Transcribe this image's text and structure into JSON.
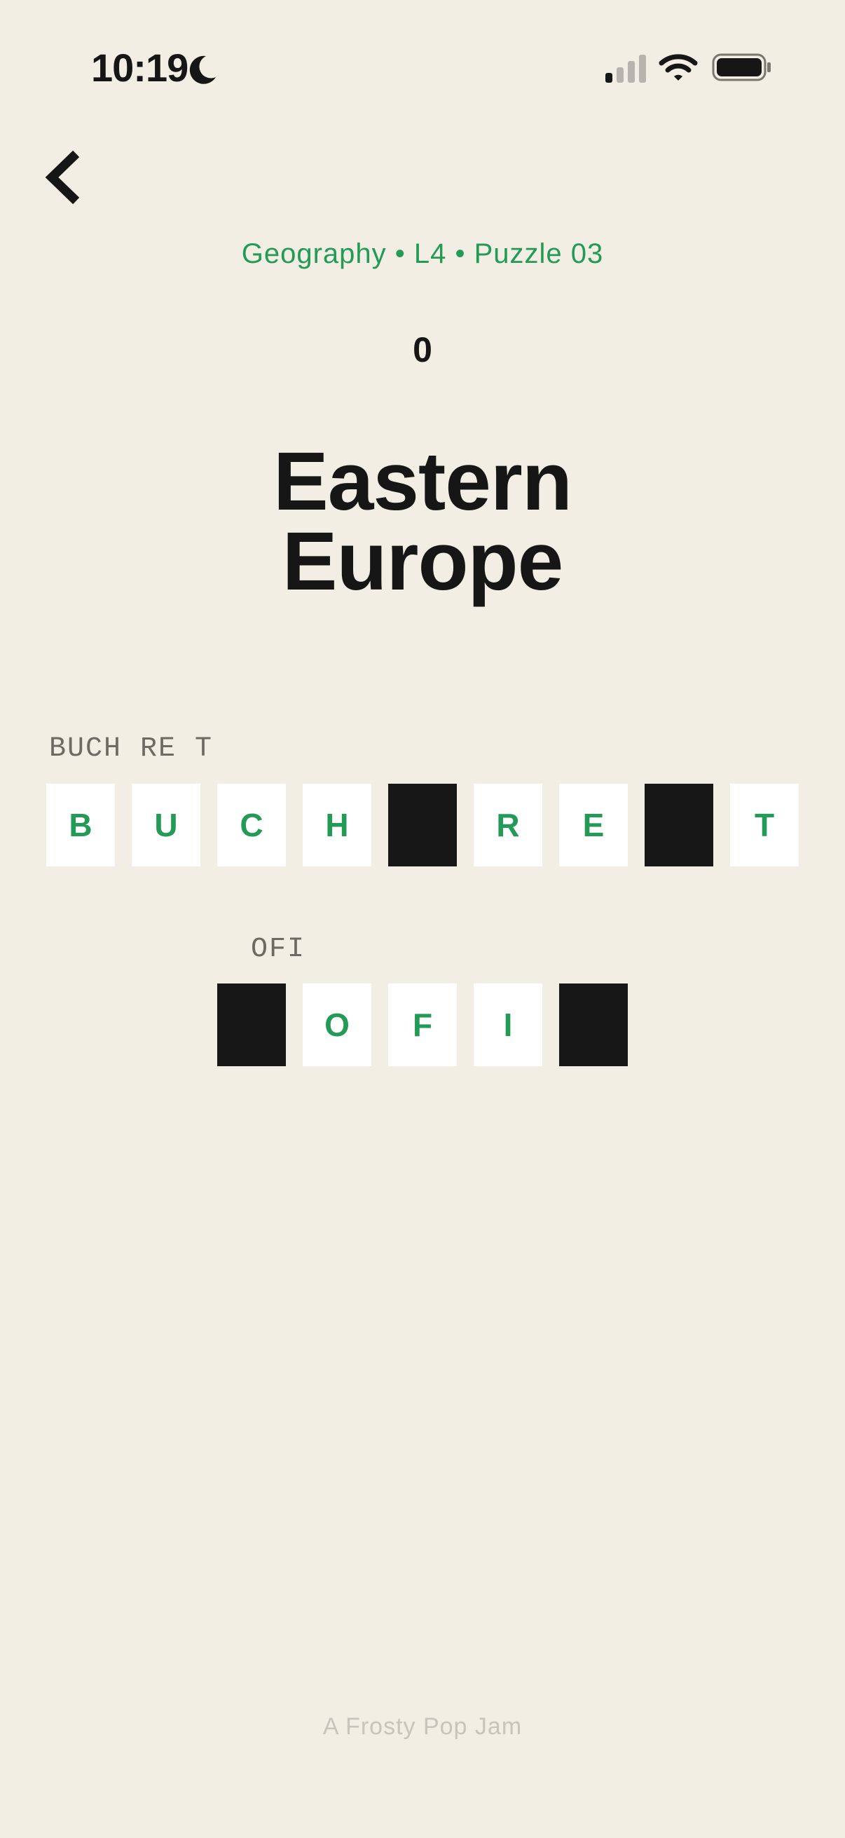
{
  "status_bar": {
    "time": "10:19",
    "icons": [
      "moon-icon",
      "cellular-signal-icon",
      "wifi-icon",
      "battery-icon"
    ]
  },
  "nav": {
    "back_icon": "chevron-left-icon"
  },
  "header": {
    "breadcrumb": "Geography • L4 • Puzzle 03",
    "score": "0",
    "title_line1": "Eastern",
    "title_line2": "Europe"
  },
  "puzzle": {
    "words": [
      {
        "hint": "BUCH RE T",
        "tiles": [
          "B",
          "U",
          "C",
          "H",
          "",
          "R",
          "E",
          "",
          "T"
        ]
      },
      {
        "hint": " OFI ",
        "tiles": [
          "",
          "O",
          "F",
          "I",
          ""
        ]
      }
    ]
  },
  "footer": {
    "credit": "A Frosty Pop Jam"
  },
  "colors": {
    "background": "#f3eee3",
    "accent_green": "#239a55",
    "text_dark": "#161616",
    "blank_tile": "#171717",
    "tile": "#ffffff",
    "hint_gray": "#6d6a64",
    "footer_gray": "#c8c4bc"
  }
}
